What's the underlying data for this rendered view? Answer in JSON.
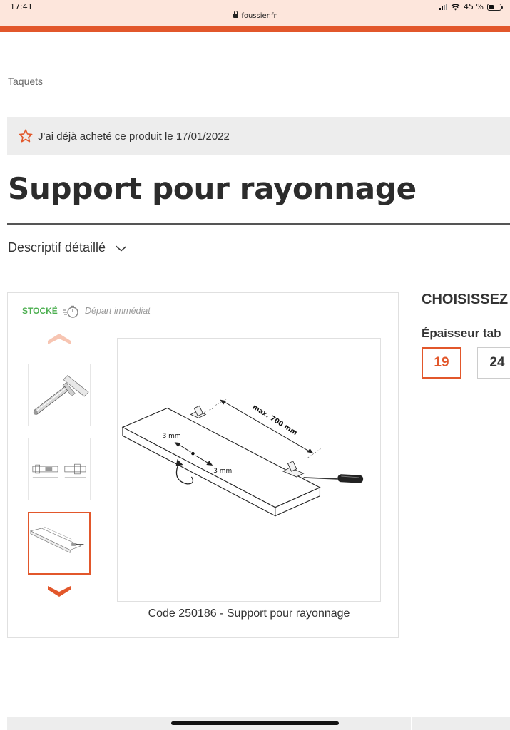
{
  "status_bar": {
    "time": "17:41",
    "url": "foussier.fr",
    "battery_text": "45 %",
    "battery_level": 0.45
  },
  "breadcrumb": "Taquets",
  "purchase_notice": {
    "text": "J'ai déjà acheté ce produit le 17/01/2022",
    "icon": "star-outline-icon"
  },
  "product": {
    "title": "Support pour rayonnage",
    "detailed_description_label": "Descriptif détaillé"
  },
  "availability": {
    "stock_label": "STOCKÉ",
    "dispatch_label": "Départ immédiat"
  },
  "gallery": {
    "selected_index": 2,
    "caption": "Code 250186 - Support pour rayonnage",
    "diagram_labels": {
      "max_length": "max. 700 mm",
      "offset_a": "3 mm",
      "offset_b": "3 mm"
    }
  },
  "options": {
    "heading": "CHOISISSEZ",
    "thickness_label": "Épaisseur tab",
    "thickness_values": [
      "19",
      "24"
    ],
    "selected": "19"
  },
  "colors": {
    "brand_orange": "#e2572b",
    "stock_green": "#4caf50",
    "status_bar_bg": "#fde6dc"
  }
}
